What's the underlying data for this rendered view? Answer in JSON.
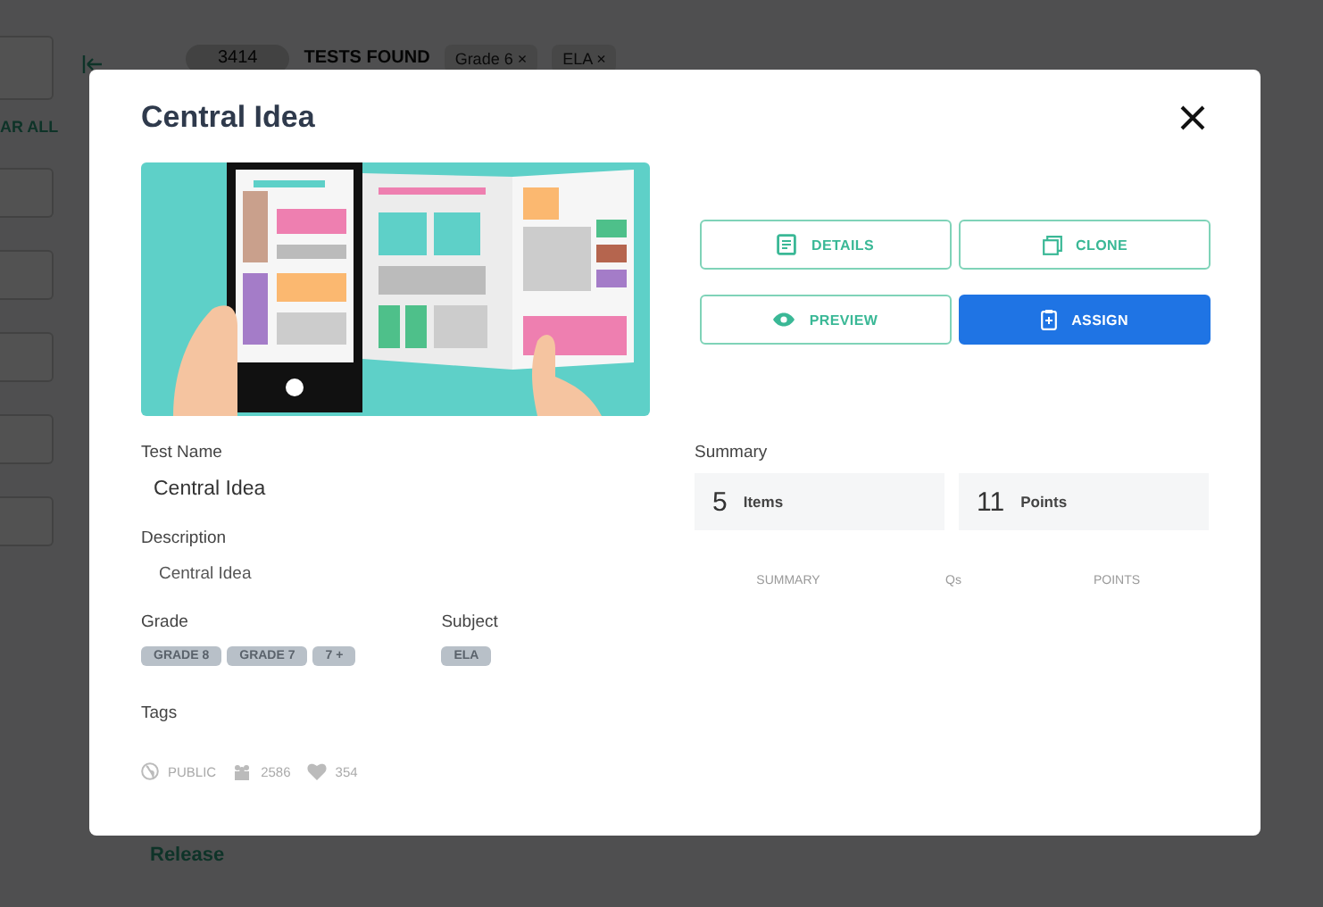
{
  "background": {
    "result_count": "3414",
    "result_label": "TESTS FOUND",
    "filters": [
      {
        "label": "Grade 6 ×"
      },
      {
        "label": "ELA ×"
      }
    ],
    "clear_all": "AR ALL",
    "row_title": "Release"
  },
  "modal": {
    "title": "Central Idea",
    "actions": [
      {
        "label": "DETAILS",
        "kind": "details",
        "primary": false
      },
      {
        "label": "CLONE",
        "kind": "clone",
        "primary": false
      },
      {
        "label": "PREVIEW",
        "kind": "preview",
        "primary": false
      },
      {
        "label": "ASSIGN",
        "kind": "assign",
        "primary": true
      }
    ],
    "test_name": {
      "label": "Test Name",
      "value": "Central Idea"
    },
    "description": {
      "label": "Description",
      "value": "Central Idea"
    },
    "grade": {
      "label": "Grade",
      "tags": [
        "GRADE 8",
        "GRADE 7",
        "7 +"
      ]
    },
    "subject": {
      "label": "Subject",
      "tags": [
        "ELA"
      ]
    },
    "tags": {
      "label": "Tags"
    },
    "stats": {
      "visibility": "PUBLIC",
      "students": "2586",
      "likes": "354"
    },
    "summary": {
      "label": "Summary",
      "cards": [
        {
          "value": "5",
          "unit": "Items"
        },
        {
          "value": "11",
          "unit": "Points"
        }
      ],
      "columns": [
        "SUMMARY",
        "Qs",
        "POINTS"
      ]
    }
  }
}
